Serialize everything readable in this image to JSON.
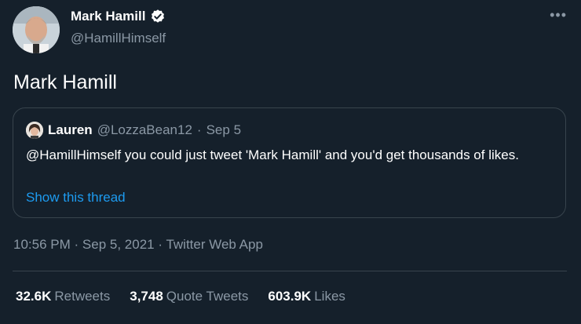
{
  "author": {
    "name": "Mark Hamill",
    "handle": "@HamillHimself",
    "verified": true
  },
  "tweet": {
    "text": "Mark Hamill"
  },
  "quote": {
    "name": "Lauren",
    "handle": "@LozzaBean12",
    "separator": "·",
    "date": "Sep 5",
    "text": "@HamillHimself you could just tweet 'Mark Hamill' and you'd get thousands of likes.",
    "link": "Show this thread"
  },
  "meta": {
    "time": "10:56 PM",
    "separator": "·",
    "date": "Sep 5, 2021",
    "source": "Twitter Web App"
  },
  "stats": [
    {
      "count": "32.6K",
      "label": "Retweets"
    },
    {
      "count": "3,748",
      "label": "Quote Tweets"
    },
    {
      "count": "603.9K",
      "label": "Likes"
    }
  ],
  "colors": {
    "background": "#15202b",
    "accent": "#1d9bf0",
    "secondary_text": "#8b98a5",
    "border": "#38444d"
  },
  "icons": {
    "verified": "verified-badge-icon",
    "more": "more-options-icon"
  }
}
